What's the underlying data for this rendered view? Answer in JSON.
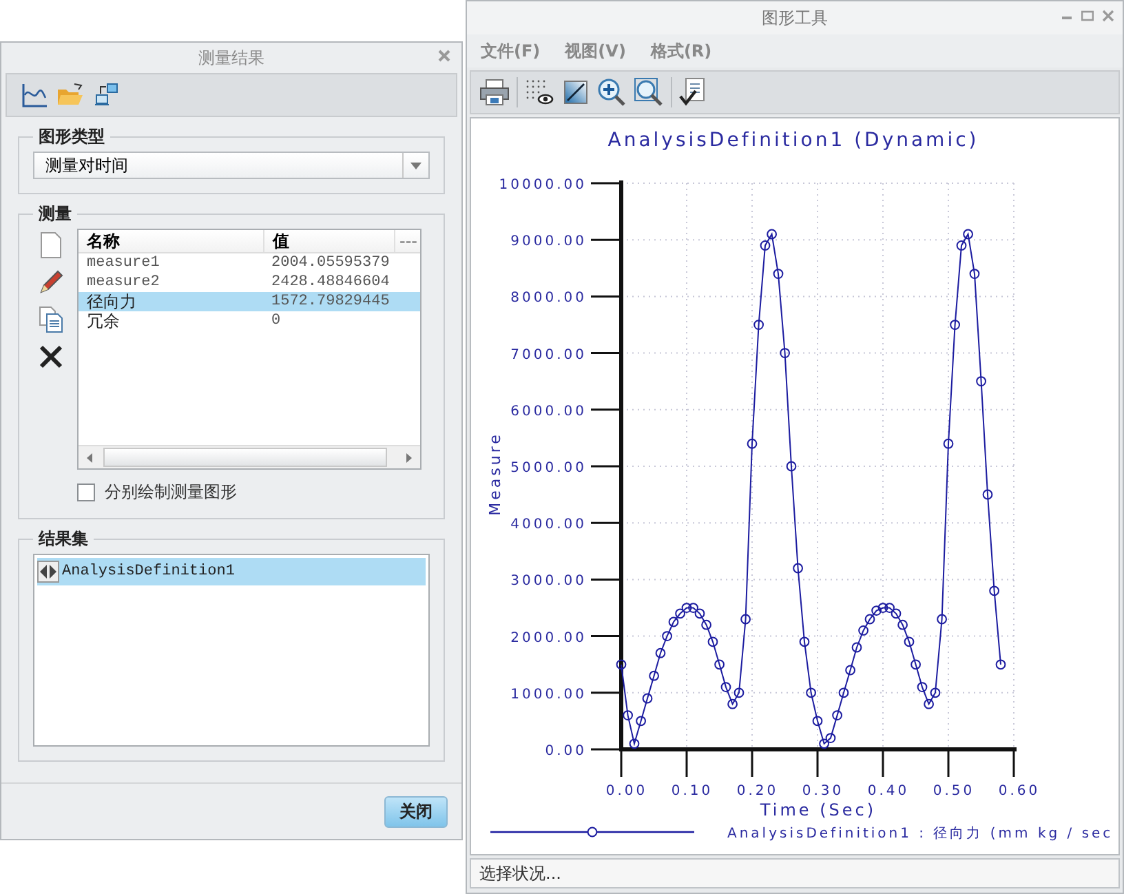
{
  "measure_dialog": {
    "title": "测量结果",
    "graph_type": {
      "label": "图形类型",
      "value": "测量对时间"
    },
    "measures": {
      "label": "测量",
      "columns": [
        "名称",
        "值",
        "---"
      ],
      "rows": [
        {
          "name": "measure1",
          "value": "2004.05595379",
          "selected": false
        },
        {
          "name": "measure2",
          "value": "2428.48846604",
          "selected": false
        },
        {
          "name": "径向力",
          "value": "1572.79829445",
          "selected": true
        },
        {
          "name": "冗余",
          "value": "0",
          "selected": false
        }
      ],
      "plot_separately": {
        "label": "分别绘制测量图形",
        "checked": false
      }
    },
    "result_sets": {
      "label": "结果集",
      "items": [
        {
          "name": "AnalysisDefinition1",
          "selected": true
        }
      ]
    },
    "buttons": [
      "关闭"
    ]
  },
  "graph_window": {
    "title": "图形工具",
    "menu": [
      "文件(F)",
      "视图(V)",
      "格式(R)"
    ],
    "chart_data": {
      "type": "line",
      "title": "AnalysisDefinition1 (Dynamic)",
      "xlabel": "Time (Sec)",
      "ylabel": "Measure",
      "x": [
        0,
        0.01,
        0.02,
        0.03,
        0.04,
        0.05,
        0.06,
        0.07,
        0.08,
        0.09,
        0.1,
        0.11,
        0.12,
        0.13,
        0.14,
        0.15,
        0.16,
        0.17,
        0.18,
        0.19,
        0.2,
        0.21,
        0.22,
        0.23,
        0.24,
        0.25,
        0.26,
        0.27,
        0.28,
        0.29,
        0.3,
        0.31,
        0.32,
        0.33,
        0.34,
        0.35,
        0.36,
        0.37,
        0.38,
        0.39,
        0.4,
        0.41,
        0.42,
        0.43,
        0.44,
        0.45,
        0.46,
        0.47,
        0.48,
        0.49,
        0.5,
        0.51,
        0.52,
        0.53,
        0.54,
        0.55,
        0.56,
        0.57,
        0.58
      ],
      "series": [
        {
          "name": "AnalysisDefinition1 : 径向力 (mm kg / sec",
          "color": "#1c1ca0",
          "marker": "circle",
          "values": [
            1500,
            600,
            100,
            500,
            900,
            1300,
            1700,
            2000,
            2250,
            2400,
            2500,
            2500,
            2400,
            2200,
            1900,
            1500,
            1100,
            800,
            1000,
            2300,
            5400,
            7500,
            8900,
            9100,
            8400,
            7000,
            5000,
            3200,
            1900,
            1000,
            500,
            100,
            200,
            600,
            1000,
            1400,
            1800,
            2100,
            2300,
            2450,
            2500,
            2500,
            2400,
            2200,
            1900,
            1500,
            1100,
            800,
            1000,
            2300,
            5400,
            7500,
            8900,
            9100,
            8400,
            6500,
            4500,
            2800,
            1500
          ]
        }
      ],
      "grid": true,
      "xlim": [
        0,
        0.6
      ],
      "ylim": [
        0,
        10000
      ],
      "xticks": [
        {
          "value": 0,
          "label": "0.00"
        },
        {
          "value": 0.1,
          "label": "0.10"
        },
        {
          "value": 0.2,
          "label": "0.20"
        },
        {
          "value": 0.3,
          "label": "0.30"
        },
        {
          "value": 0.4,
          "label": "0.40"
        },
        {
          "value": 0.5,
          "label": "0.50"
        },
        {
          "value": 0.6,
          "label": "0.60"
        }
      ],
      "yticks": [
        {
          "value": 0,
          "label": "0.00"
        },
        {
          "value": 1000,
          "label": "1000.00"
        },
        {
          "value": 2000,
          "label": "2000.00"
        },
        {
          "value": 3000,
          "label": "3000.00"
        },
        {
          "value": 4000,
          "label": "4000.00"
        },
        {
          "value": 5000,
          "label": "5000.00"
        },
        {
          "value": 6000,
          "label": "6000.00"
        },
        {
          "value": 7000,
          "label": "7000.00"
        },
        {
          "value": 8000,
          "label": "8000.00"
        },
        {
          "value": 9000,
          "label": "9000.00"
        },
        {
          "value": 10000,
          "label": "10000.00"
        }
      ]
    },
    "status_bar": "选择状况..."
  }
}
